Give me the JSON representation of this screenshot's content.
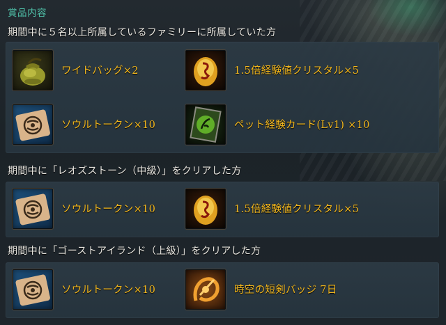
{
  "header": {
    "title": "賞品内容"
  },
  "groups": [
    {
      "condition": "期間中に５名以上所属しているファミリーに所属していた方",
      "rewards": [
        {
          "label": "ワイドバッグ×2",
          "icon": "bag-icon"
        },
        {
          "label": "1.5倍経験値クリスタル×5",
          "icon": "experience-crystal-icon"
        },
        {
          "label": "ソウルトークン×10",
          "icon": "soul-token-icon"
        },
        {
          "label": "ペット経験カード(Lv1) ×10",
          "icon": "pet-exp-card-icon"
        }
      ]
    },
    {
      "condition": "期間中に「レオズストーン（中級）」をクリアした方",
      "rewards": [
        {
          "label": "ソウルトークン×10",
          "icon": "soul-token-icon"
        },
        {
          "label": "1.5倍経験値クリスタル×5",
          "icon": "experience-crystal-icon"
        }
      ]
    },
    {
      "condition": "期間中に「ゴーストアイランド（上級）」をクリアした方",
      "rewards": [
        {
          "label": "ソウルトークン×10",
          "icon": "soul-token-icon"
        },
        {
          "label": "時空の短剣バッジ 7日",
          "icon": "dagger-badge-icon"
        }
      ]
    }
  ],
  "colors": {
    "title": "#4fc0a8",
    "condition_text": "#e8e6e0",
    "reward_text": "#f3b71c",
    "panel": "#2c3a44"
  }
}
